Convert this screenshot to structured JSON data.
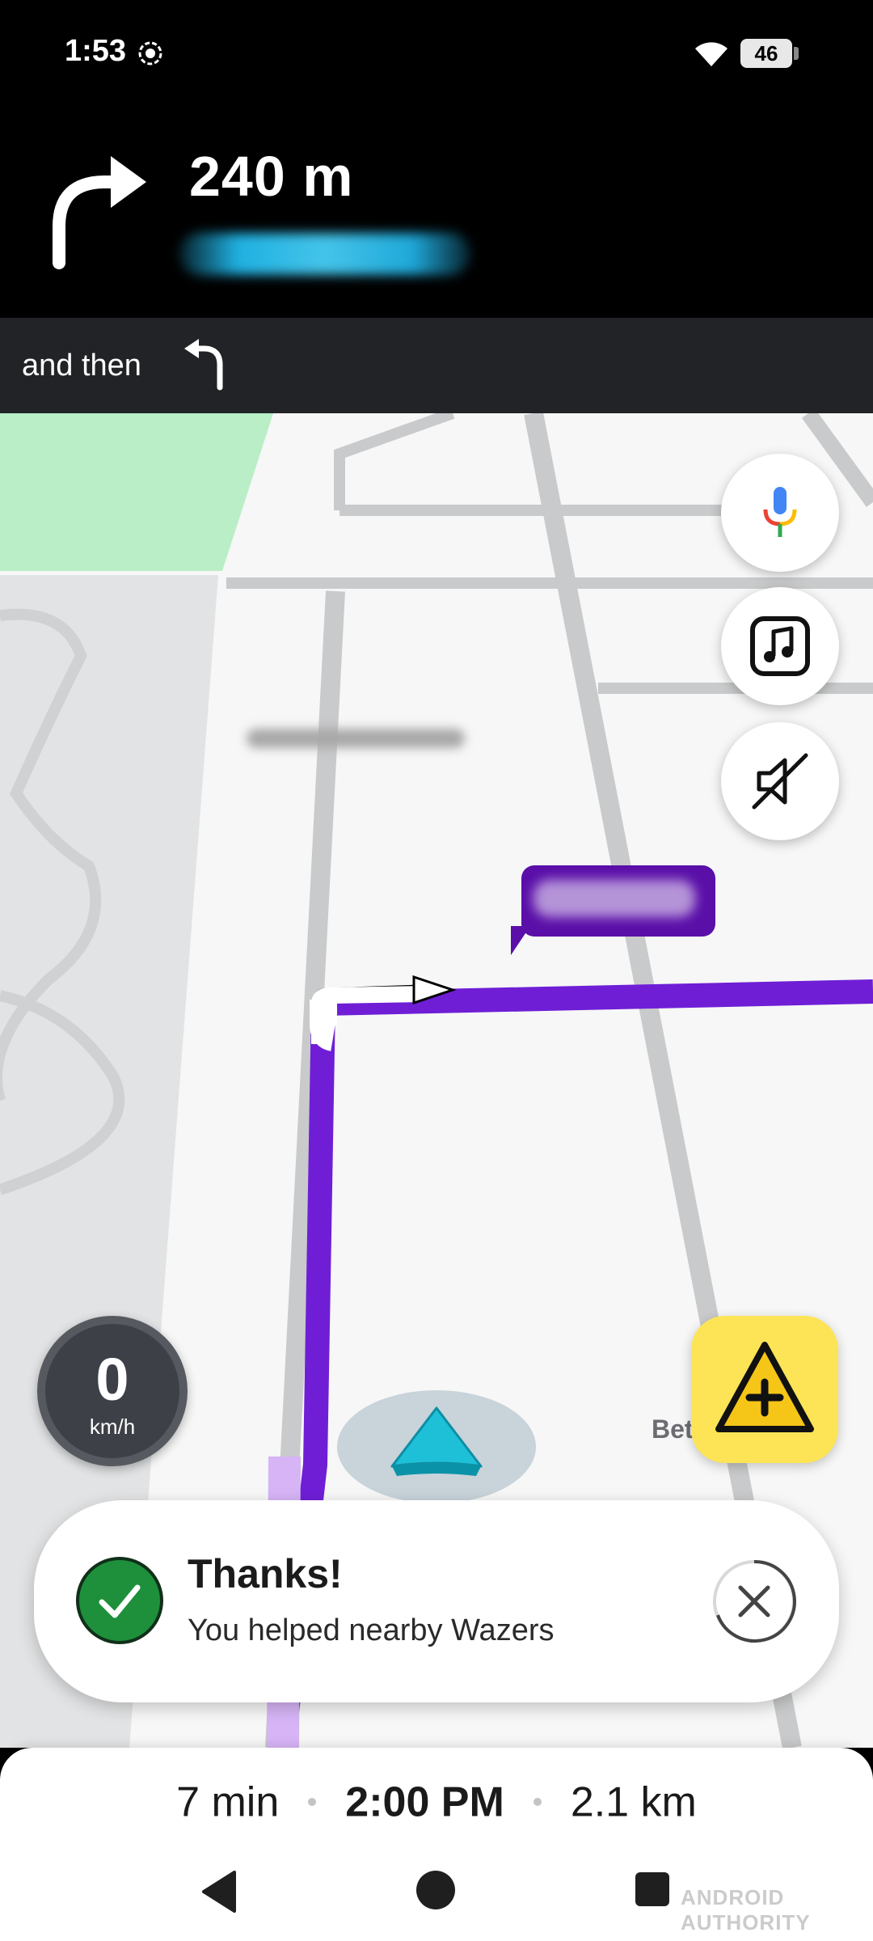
{
  "status_bar": {
    "time": "1:53",
    "battery": "46"
  },
  "navigation": {
    "distance": "240 m",
    "street_name_obscured": true,
    "next_turn_icon": "turn-right-icon",
    "then_label": "and then",
    "then_turn_icon": "turn-left-icon"
  },
  "map": {
    "route_color": "#6f1ed6",
    "map_label_partial": "Bet",
    "buttons": {
      "voice": "google-mic-icon",
      "music": "music-icon",
      "sound": "sound-off-icon",
      "report": "report-hazard-icon"
    }
  },
  "speedometer": {
    "value": "0",
    "unit": "km/h"
  },
  "toast": {
    "title": "Thanks!",
    "subtitle": "You helped nearby Wazers"
  },
  "eta": {
    "duration": "7 min",
    "arrival": "2:00 PM",
    "distance": "2.1 km"
  },
  "watermark": "ANDROID AUTHORITY",
  "colors": {
    "report_yellow": "#fde457",
    "success_green": "#1e8f3b",
    "street_blue": "#1fb0e0",
    "route_purple": "#6f1ed6"
  }
}
